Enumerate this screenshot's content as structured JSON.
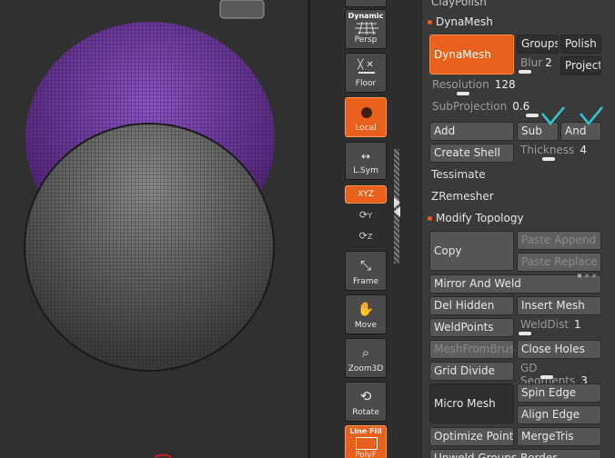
{
  "viewport": {
    "colors": {
      "purple": "#7a3fb0",
      "gray": "#6a6a6a",
      "bg": "#303030"
    }
  },
  "shelf": {
    "dynamic_label": "Dynamic",
    "persp_label": "Persp",
    "floor_label": "Floor",
    "local_label": "Local",
    "lsym_label": "L.Sym",
    "xyz_label": "XYZ",
    "y_label": "Y",
    "z_label": "Z",
    "frame_label": "Frame",
    "move_label": "Move",
    "zoom3d_label": "Zoom3D",
    "rotate_label": "Rotate",
    "linefill_label": "Line Fill",
    "polyf_label": "PolyF"
  },
  "palette": {
    "top_cut_label": "ClayPolish",
    "dynamesh_header": "DynaMesh",
    "dynamesh_button": "DynaMesh",
    "groups": "Groups",
    "polish": "Polish",
    "blur_label": "Blur",
    "blur_value": "2",
    "project": "Project",
    "resolution_label": "Resolution",
    "resolution_value": "128",
    "subprojection_label": "SubProjection",
    "subprojection_value": "0.6",
    "add": "Add",
    "sub": "Sub",
    "and": "And",
    "create_shell": "Create Shell",
    "thickness_label": "Thickness",
    "thickness_value": "4",
    "tessimate": "Tessimate",
    "zremesher": "ZRemesher",
    "modify_topology_header": "Modify Topology",
    "copy": "Copy",
    "paste_append": "Paste Append",
    "paste_replace": "Paste Replace",
    "mirror_and_weld": "Mirror And Weld",
    "del_hidden": "Del Hidden",
    "insert_mesh": "Insert Mesh",
    "weldpoints": "WeldPoints",
    "welddist_label": "WeldDist",
    "welddist_value": "1",
    "meshfrombrush": "MeshFromBrush",
    "close_holes": "Close Holes",
    "grid_divide": "Grid Divide",
    "gd_segments_label": "GD Segments",
    "gd_segments_value": "3",
    "micro_mesh": "Micro Mesh",
    "spin_edge": "Spin Edge",
    "align_edge": "Align Edge",
    "optimize_points": "Optimize Points",
    "mergetris": "MergeTris",
    "unweld_groups_border": "Unweld Groups Border",
    "accent": "#e8601c",
    "check_color": "#2ec8d8"
  }
}
